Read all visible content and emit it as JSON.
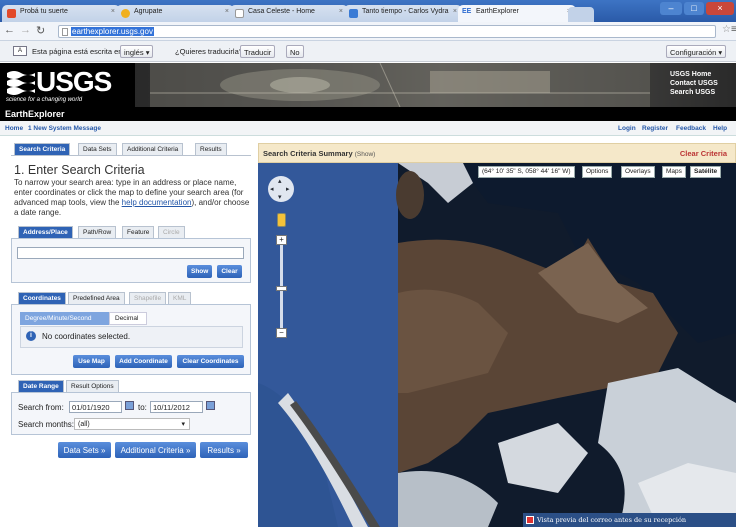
{
  "browser": {
    "tabs": [
      {
        "label": "Probá tu suerte",
        "color": "#e24a2a"
      },
      {
        "label": "Agrupate",
        "color": "#f0b020"
      },
      {
        "label": "Casa Celeste - Home",
        "color": "#ffffff"
      },
      {
        "label": "Tanto tiempo - Carlos Vydra",
        "color": "#3a7bd5"
      },
      {
        "label": "EarthExplorer",
        "color": "#3a7bd5",
        "fav_text": "EE"
      }
    ],
    "url": "earthexplorer.usgs.gov"
  },
  "translate": {
    "message_prefix": "Esta página está escrita en",
    "language": "inglés",
    "question": "¿Quieres traducirla?",
    "translate_btn": "Traducir",
    "no_btn": "No",
    "config_btn": "Configuración"
  },
  "usgs": {
    "logo": "USGS",
    "tagline": "science for a changing world",
    "links": [
      "USGS Home",
      "Contact USGS",
      "Search USGS"
    ]
  },
  "app_title": "EarthExplorer",
  "links_bar": {
    "home": "Home",
    "message": "1 New System Message",
    "login": "Login",
    "register": "Register",
    "feedback": "Feedback",
    "help": "Help"
  },
  "left": {
    "tabs": [
      "Search Criteria",
      "Data Sets",
      "Additional Criteria",
      "Results"
    ],
    "heading": "1. Enter Search Criteria",
    "desc_1": "To narrow your search area: type in an address or place name, enter coordinates or click the map to define your search area (for advanced map tools, view the",
    "help_link": "help documentation",
    "desc_2": "), and/or choose a date range.",
    "addr_tabs": [
      "Address/Place",
      "Path/Row",
      "Feature",
      "Circle"
    ],
    "show_btn": "Show",
    "clear_btn": "Clear",
    "coord_tabs": [
      "Coordinates",
      "Predefined Area",
      "Shapefile",
      "KML"
    ],
    "format_tabs": [
      "Degree/Minute/Second",
      "Decimal"
    ],
    "no_coords": "No coordinates selected.",
    "use_map_btn": "Use Map",
    "add_coord_btn": "Add Coordinate",
    "clear_coords_btn": "Clear Coordinates",
    "date_tabs": [
      "Date Range",
      "Result Options"
    ],
    "search_from_label": "Search from:",
    "search_from_value": "01/01/1920",
    "to_label": "to:",
    "to_value": "10/11/2012",
    "months_label": "Search months:",
    "months_value": "(all)",
    "nav_buttons": [
      "Data Sets »",
      "Additional Criteria »",
      "Results »"
    ]
  },
  "map": {
    "summary_title": "Search Criteria Summary",
    "summary_show": "(Show)",
    "clear_criteria": "Clear Criteria",
    "coord_readout": "(64° 10' 35\" S, 058° 44' 16\" W)",
    "options": "Options",
    "overlays": "Overlays",
    "maps": "Maps",
    "satellite": "Satélite",
    "notification": "Vista previa del correo antes de su recepción"
  }
}
